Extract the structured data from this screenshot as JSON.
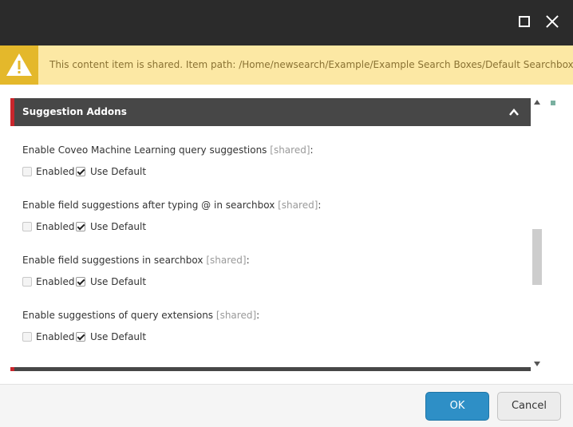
{
  "window": {
    "maximize_icon": "maximize-icon",
    "close_icon": "close-icon"
  },
  "warning": {
    "icon": "warning-icon",
    "text": "This content item is shared. Item path: /Home/newsearch/Example/Example Search Boxes/Default Searchbox",
    "colors": {
      "background": "#fce8a4",
      "icon_background": "#e4b82b"
    }
  },
  "section": {
    "title": "Suggestion Addons",
    "collapse_icon": "chevron-up-icon",
    "accent_color": "#c9262c",
    "fields": [
      {
        "label": "Enable Coveo Machine Learning query suggestions",
        "shared": "[shared]",
        "suffix": ":",
        "enabled_label": "Enabled",
        "enabled_checked": false,
        "default_label": "Use Default",
        "default_checked": true
      },
      {
        "label": "Enable field suggestions after typing @ in searchbox",
        "shared": "[shared]",
        "suffix": ":",
        "enabled_label": "Enabled",
        "enabled_checked": false,
        "default_label": "Use Default",
        "default_checked": true
      },
      {
        "label": "Enable field suggestions in searchbox",
        "shared": "[shared]",
        "suffix": ":",
        "enabled_label": "Enabled",
        "enabled_checked": false,
        "default_label": "Use Default",
        "default_checked": true
      },
      {
        "label": "Enable suggestions of query extensions",
        "shared": "[shared]",
        "suffix": ":",
        "enabled_label": "Enabled",
        "enabled_checked": false,
        "default_label": "Use Default",
        "default_checked": true
      }
    ]
  },
  "footer": {
    "ok_label": "OK",
    "cancel_label": "Cancel",
    "ok_color": "#2e8fc6"
  }
}
